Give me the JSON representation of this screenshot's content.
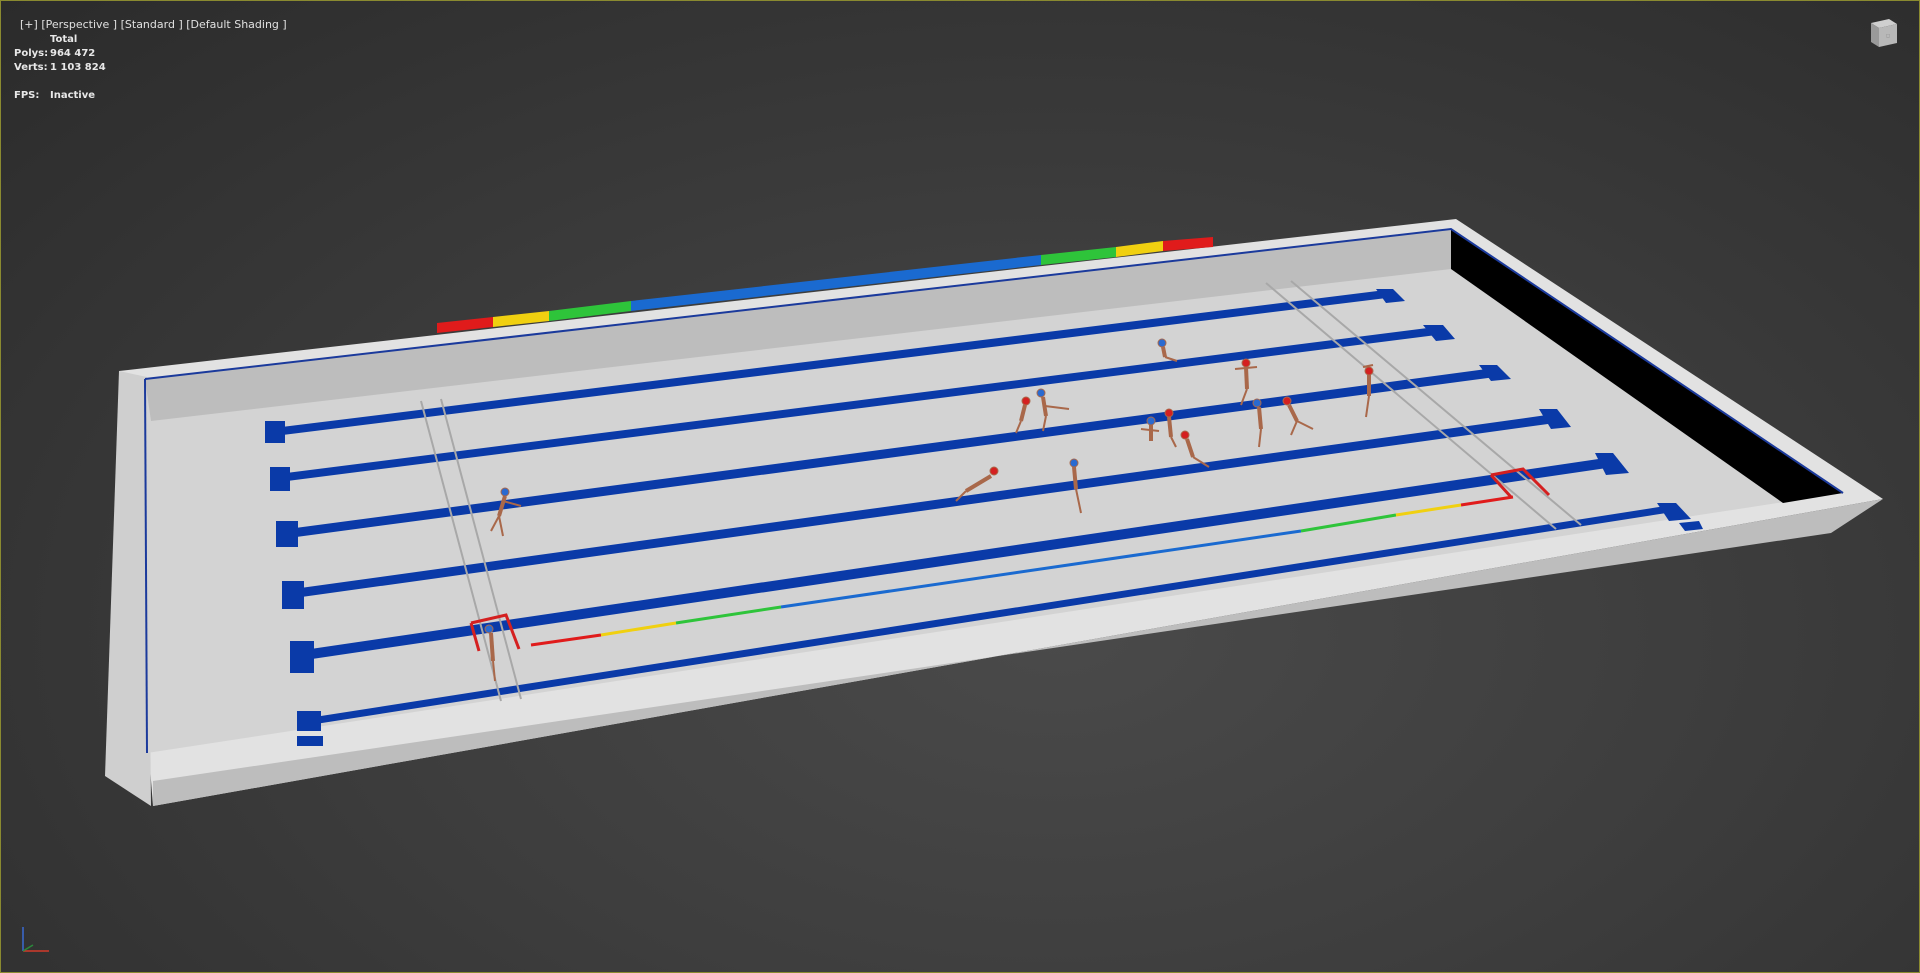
{
  "viewport": {
    "label": "[+] [Perspective ] [Standard ] [Default Shading ]",
    "menu_plus": "[+]",
    "menu_view": "[Perspective ]",
    "menu_mode": "[Standard ]",
    "menu_shading": "[Default Shading ]"
  },
  "stats": {
    "header": "Total",
    "polys_label": "Polys:",
    "polys_value": "964 472",
    "verts_label": "Verts:",
    "verts_value": "1 103 824",
    "fps_label": "FPS:",
    "fps_value": "Inactive"
  },
  "viewcube": {
    "icon": "viewcube-icon"
  },
  "axis_tripod": {
    "icon": "axis-tripod-icon",
    "x_color": "#d23a2a",
    "y_color": "#2a8a3a",
    "z_color": "#3a6ad2"
  },
  "scene": {
    "pool_floor_color": "#d4d4d4",
    "lane_line_color": "#0a3aa8",
    "deck_color": "#e6e6e6",
    "wall_side_color": "#000000",
    "scoreboard_colors": [
      "#e01b1b",
      "#f0d010",
      "#2ec43a",
      "#1a6ad0"
    ],
    "goal_color": "#d42020"
  }
}
